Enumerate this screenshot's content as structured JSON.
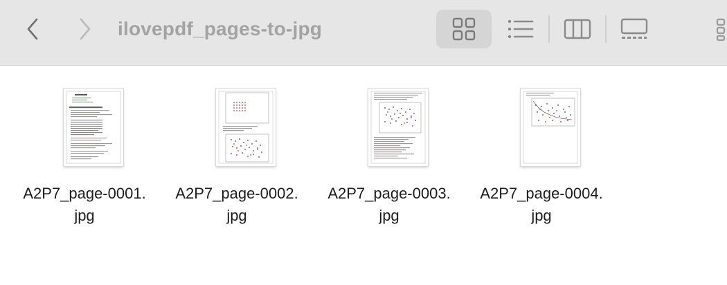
{
  "window": {
    "title": "ilovepdf_pages-to-jpg"
  },
  "toolbar": {
    "back_icon": "chevron-left-icon",
    "forward_icon": "chevron-right-icon",
    "view_modes": [
      {
        "name": "icon-view",
        "icon": "grid-icon",
        "selected": true
      },
      {
        "name": "list-view",
        "icon": "list-icon",
        "selected": false
      },
      {
        "name": "column-view",
        "icon": "columns-icon",
        "selected": false
      },
      {
        "name": "gallery-view",
        "icon": "gallery-icon",
        "selected": false
      }
    ]
  },
  "files": [
    {
      "line1": "A2P7_page-0001.",
      "line2": "jpg"
    },
    {
      "line1": "A2P7_page-0002.",
      "line2": "jpg"
    },
    {
      "line1": "A2P7_page-0003.",
      "line2": "jpg"
    },
    {
      "line1": "A2P7_page-0004.",
      "line2": "jpg"
    }
  ],
  "colors": {
    "toolbar_bg": "#e6e6e6",
    "selected_view_bg": "#d5d5d5",
    "title_text": "#a3a3a3",
    "icon_gray": "#8a8a8a"
  }
}
